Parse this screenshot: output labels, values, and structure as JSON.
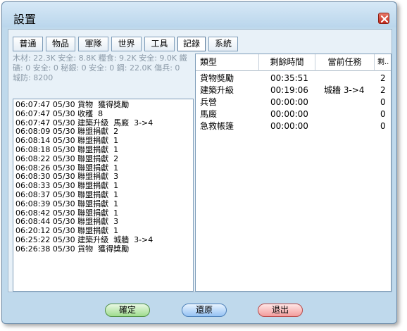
{
  "window": {
    "title": "設置"
  },
  "tabs": [
    "普通",
    "物品",
    "軍隊",
    "世界",
    "工具",
    "記錄",
    "系統"
  ],
  "active_tab": "記錄",
  "resources": {
    "line1": "木材: 22.3K 安全: 8.8K  糧食: 9.2K 安全: 9.0K  鐵",
    "line2": "礦: 0 安全: 0  秘銀: 0 安全: 0  鋼: 22.0K  傷兵: 0",
    "line3": "城防: 8200"
  },
  "log": [
    "06:07:47 05/30 貨物  獲得獎勵",
    "06:07:47 05/30 收穫  8",
    "06:07:47 05/30 建築升級  馬廄  3->4",
    "06:08:09 05/30 聯盟捐獻  2",
    "06:08:14 05/30 聯盟捐獻  1",
    "06:08:18 05/30 聯盟捐獻  1",
    "06:08:22 05/30 聯盟捐獻  2",
    "06:08:26 05/30 聯盟捐獻  1",
    "06:08:30 05/30 聯盟捐獻  3",
    "06:08:33 05/30 聯盟捐獻  1",
    "06:08:37 05/30 聯盟捐獻  1",
    "06:08:39 05/30 聯盟捐獻  1",
    "06:08:42 05/30 聯盟捐獻  1",
    "06:08:44 05/30 聯盟捐獻  3",
    "06:20:12 05/30 聯盟捐獻  1",
    "06:25:22 05/30 建築升級  城牆  3->4",
    "06:26:38 05/30 貨物  獲得獎勵"
  ],
  "table": {
    "headers": [
      "類型",
      "剩餘時間",
      "當前任務",
      "剩.."
    ],
    "rows": [
      [
        "貨物獎勵",
        "00:35:51",
        "",
        "2"
      ],
      [
        "建築升級",
        "00:19:06",
        "城牆 3->4",
        "2"
      ],
      [
        "兵營",
        "00:00:00",
        "",
        "0"
      ],
      [
        "馬廄",
        "00:00:00",
        "",
        "0"
      ],
      [
        "急救帳篷",
        "00:00:00",
        "",
        "0"
      ]
    ]
  },
  "buttons": {
    "ok": "確定",
    "reset": "還原",
    "exit": "退出"
  },
  "colors": {
    "window_bg": "#bfd9ec",
    "panel_bg": "#e8f1f8",
    "resource_text": "#8b9aa8"
  }
}
